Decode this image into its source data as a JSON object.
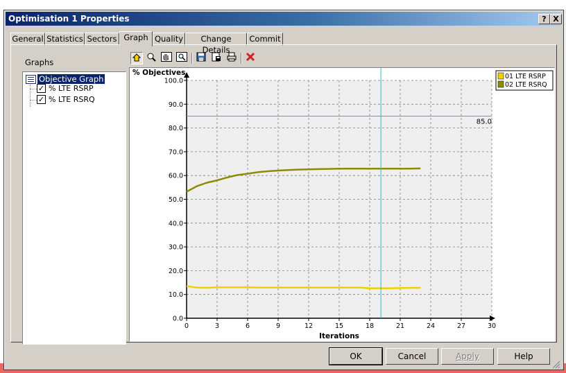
{
  "window": {
    "title": "Optimisation 1 Properties",
    "help_button": "?",
    "close_button": "X"
  },
  "tabs": [
    "General",
    "Statistics",
    "Sectors",
    "Graph",
    "Quality",
    "Change Details",
    "Commit"
  ],
  "active_tab": "Graph",
  "graphs_panel": {
    "label": "Graphs",
    "root": "Objective Graph",
    "items": [
      {
        "label": "% LTE RSRP",
        "checked": true
      },
      {
        "label": "% LTE RSRQ",
        "checked": true
      }
    ]
  },
  "toolbar": {
    "buttons": [
      "home-icon",
      "zoom-icon",
      "pan-icon",
      "zoom-region-icon",
      "save-icon",
      "export-icon",
      "print-icon",
      "delete-icon"
    ]
  },
  "chart_data": {
    "type": "line",
    "ylabel": "% Objectives",
    "xlabel": "Iterations",
    "xlim": [
      0,
      30
    ],
    "ylim": [
      0,
      100
    ],
    "x_ticks": [
      "0",
      "3",
      "6",
      "9",
      "12",
      "15",
      "18",
      "21",
      "24",
      "27",
      "30"
    ],
    "y_ticks": [
      "0.0",
      "10.0",
      "20.0",
      "30.0",
      "40.0",
      "50.0",
      "60.0",
      "70.0",
      "80.0",
      "90.0",
      "100.0"
    ],
    "threshold": {
      "value": 85.0,
      "label": "85.0",
      "color": "#6b8fd9"
    },
    "cursor_x": 19.1,
    "cursor_color": "#00d2d2",
    "grid": true,
    "legend_position": "top-right",
    "series": [
      {
        "name": "01 LTE RSRP",
        "color": "#f0d000",
        "x": [
          0,
          1,
          2,
          3,
          4,
          5,
          6,
          7,
          8,
          9,
          10,
          11,
          12,
          13,
          14,
          15,
          16,
          17,
          18,
          19,
          20,
          21,
          22,
          23
        ],
        "y": [
          13.5,
          12.9,
          12.8,
          13.0,
          13.0,
          13.0,
          13.0,
          12.9,
          12.9,
          12.9,
          12.9,
          12.9,
          12.9,
          12.9,
          12.9,
          12.9,
          12.9,
          12.9,
          12.6,
          12.6,
          12.6,
          12.7,
          12.8,
          12.8
        ]
      },
      {
        "name": "02 LTE RSRQ",
        "color": "#8c8c00",
        "x": [
          0,
          1,
          2,
          3,
          4,
          5,
          6,
          7,
          8,
          9,
          10,
          11,
          12,
          13,
          14,
          15,
          16,
          17,
          18,
          19,
          20,
          21,
          22,
          23
        ],
        "y": [
          53.2,
          55.5,
          57.0,
          58.0,
          59.2,
          60.2,
          60.8,
          61.4,
          61.8,
          62.1,
          62.3,
          62.5,
          62.6,
          62.7,
          62.8,
          62.9,
          62.9,
          62.9,
          62.9,
          62.9,
          62.9,
          62.9,
          62.9,
          63.0
        ]
      }
    ]
  },
  "footer": {
    "ok": "OK",
    "cancel": "Cancel",
    "apply": "Apply",
    "help": "Help"
  }
}
